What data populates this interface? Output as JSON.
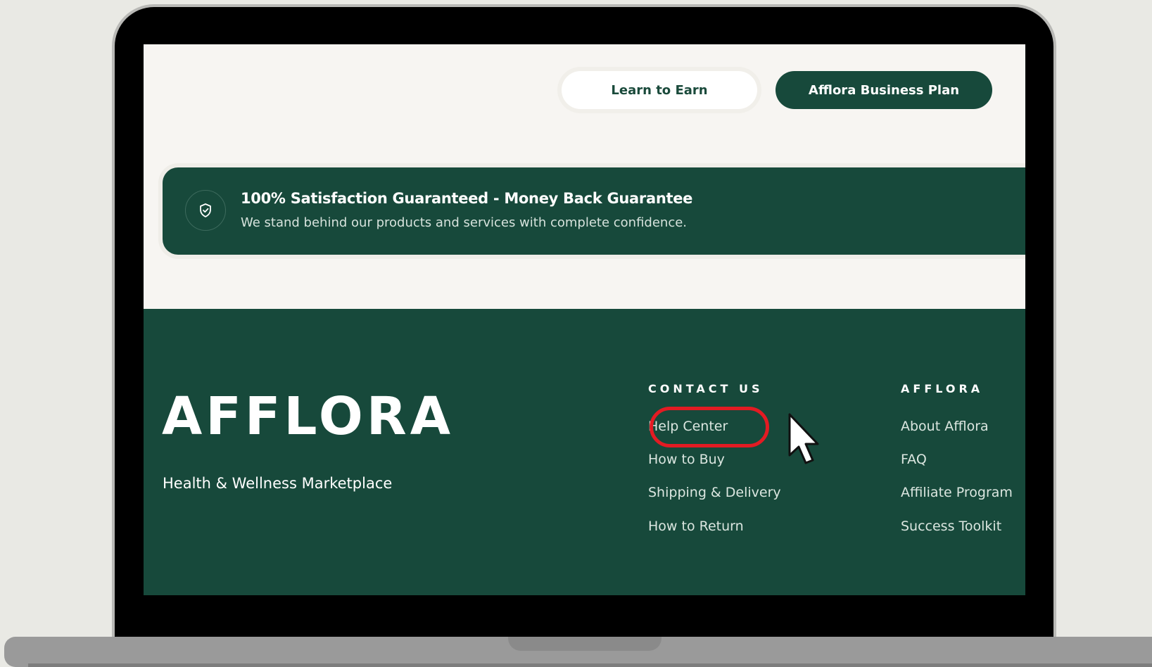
{
  "top_buttons": {
    "learn_label": "Learn to Earn",
    "plan_label": "Afflora Business Plan"
  },
  "banner": {
    "icon": "shield-check-icon",
    "title": "100% Satisfaction Guaranteed - Money Back Guarantee",
    "subtitle": "We stand behind our products and services with complete confidence."
  },
  "footer": {
    "logo": "AFFLORA",
    "tagline": "Health & Wellness Marketplace",
    "contact": {
      "heading": "CONTACT US",
      "links": [
        "Help Center",
        "How to Buy",
        "Shipping & Delivery",
        "How to Return"
      ]
    },
    "afflora": {
      "heading": "AFFLORA",
      "links": [
        "About Afflora",
        "FAQ",
        "Affiliate Program",
        "Success Toolkit"
      ]
    }
  },
  "annotation": {
    "highlighted_item": "Help Center",
    "ring_color": "#e31b23",
    "pointer_icon": "mouse-cursor-icon"
  },
  "colors": {
    "brand_green": "#17493b",
    "page_bg": "#f7f5f2"
  }
}
